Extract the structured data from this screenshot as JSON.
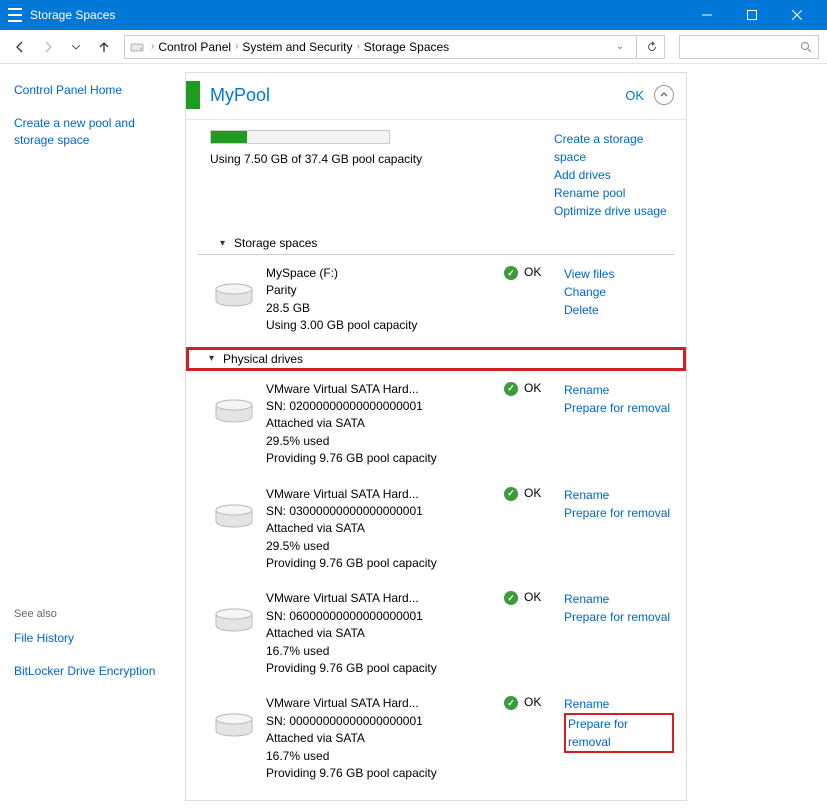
{
  "window_title": "Storage Spaces",
  "breadcrumb": [
    "Control Panel",
    "System and Security",
    "Storage Spaces"
  ],
  "sidebar": {
    "home": "Control Panel Home",
    "create": "Create a new pool and storage space",
    "seealso_heading": "See also",
    "file_history": "File History",
    "bitlocker": "BitLocker Drive Encryption"
  },
  "pool": {
    "name": "MyPool",
    "status": "OK",
    "usage": "Using 7.50 GB of 37.4 GB pool capacity",
    "links": {
      "create": "Create a storage space",
      "add": "Add drives",
      "rename": "Rename pool",
      "optimize": "Optimize drive usage"
    }
  },
  "sections": {
    "storage_spaces": "Storage spaces",
    "physical_drives": "Physical drives"
  },
  "space": {
    "name": "MySpace (F:)",
    "type": "Parity",
    "size": "28.5 GB",
    "usage": "Using 3.00 GB pool capacity",
    "status": "OK",
    "links": {
      "view": "View files",
      "change": "Change",
      "delete": "Delete"
    }
  },
  "drives": [
    {
      "name": "VMware Virtual SATA Hard...",
      "sn": "SN: 02000000000000000001",
      "attached": "Attached via SATA",
      "used": "29.5% used",
      "providing": "Providing 9.76 GB pool capacity",
      "status": "OK",
      "rename": "Rename",
      "prepare": "Prepare for removal"
    },
    {
      "name": "VMware Virtual SATA Hard...",
      "sn": "SN: 03000000000000000001",
      "attached": "Attached via SATA",
      "used": "29.5% used",
      "providing": "Providing 9.76 GB pool capacity",
      "status": "OK",
      "rename": "Rename",
      "prepare": "Prepare for removal"
    },
    {
      "name": "VMware Virtual SATA Hard...",
      "sn": "SN: 06000000000000000001",
      "attached": "Attached via SATA",
      "used": "16.7% used",
      "providing": "Providing 9.76 GB pool capacity",
      "status": "OK",
      "rename": "Rename",
      "prepare": "Prepare for removal"
    },
    {
      "name": "VMware Virtual SATA Hard...",
      "sn": "SN: 00000000000000000001",
      "attached": "Attached via SATA",
      "used": "16.7% used",
      "providing": "Providing 9.76 GB pool capacity",
      "status": "OK",
      "rename": "Rename",
      "prepare": "Prepare for removal"
    }
  ]
}
